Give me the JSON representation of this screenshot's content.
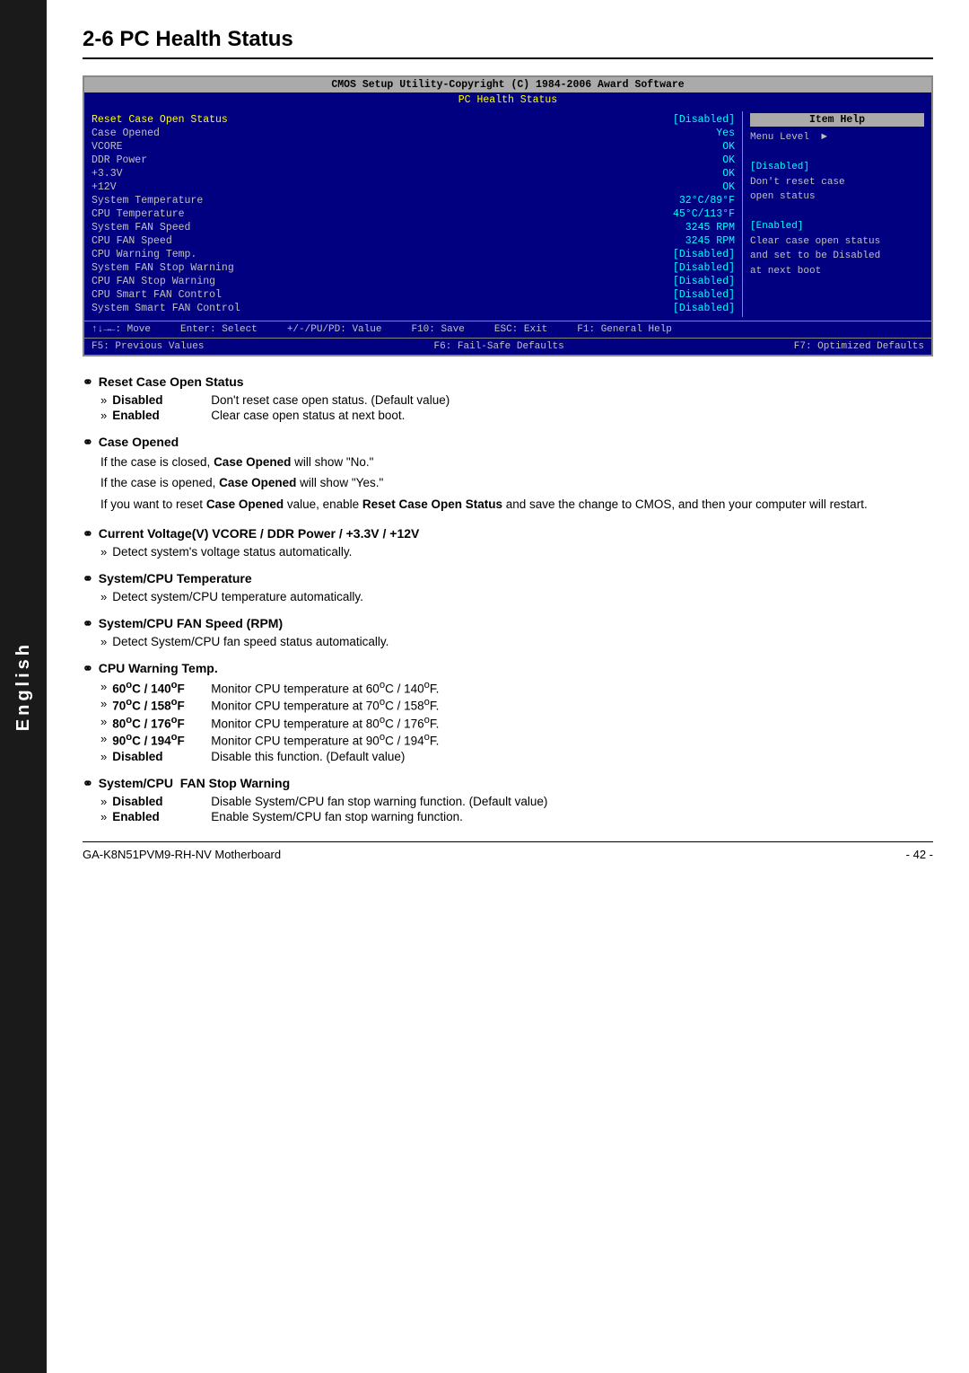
{
  "sidebar": {
    "label": "English"
  },
  "page": {
    "title": "2-6   PC Health Status"
  },
  "bios": {
    "title_bar": "CMOS Setup Utility-Copyright (C) 1984-2006 Award Software",
    "subtitle": "PC Health Status",
    "rows": [
      {
        "label": "Reset Case Open Status",
        "value": "[Disabled]",
        "highlight": true
      },
      {
        "label": "Case Opened",
        "value": "Yes",
        "highlight": false
      },
      {
        "label": "VCORE",
        "value": "OK",
        "highlight": false
      },
      {
        "label": "DDR Power",
        "value": "OK",
        "highlight": false
      },
      {
        "label": "+3.3V",
        "value": "OK",
        "highlight": false
      },
      {
        "label": "+12V",
        "value": "OK",
        "highlight": false
      },
      {
        "label": "System Temperature",
        "value": "32°C/89°F",
        "highlight": false
      },
      {
        "label": "CPU Temperature",
        "value": "45°C/113°F",
        "highlight": false
      },
      {
        "label": "System FAN Speed",
        "value": "3245 RPM",
        "highlight": false
      },
      {
        "label": "CPU FAN Speed",
        "value": "3245 RPM",
        "highlight": false
      },
      {
        "label": "CPU Warning Temp.",
        "value": "[Disabled]",
        "highlight": false
      },
      {
        "label": "System FAN Stop Warning",
        "value": "[Disabled]",
        "highlight": false
      },
      {
        "label": "CPU FAN Stop Warning",
        "value": "[Disabled]",
        "highlight": false
      },
      {
        "label": "CPU Smart FAN Control",
        "value": "[Disabled]",
        "highlight": false
      },
      {
        "label": "System Smart FAN Control",
        "value": "[Disabled]",
        "highlight": false
      }
    ],
    "item_help_title": "Item Help",
    "item_help_lines": [
      "Menu Level  ▶",
      "",
      "[Disabled]",
      "Don't reset case",
      "open status",
      "",
      "[Enabled]",
      "Clear case open status",
      "and set to be Disabled",
      "at next boot"
    ],
    "footer_left": "↑↓→←: Move    Enter: Select    +/-/PU/PD: Value    F10: Save    ESC: Exit    F1: General Help",
    "footer_left1": "↑↓→←: Move",
    "footer_left2": "Enter: Select",
    "footer_mid1": "+/-/PU/PD: Value",
    "footer_mid2": "F10: Save",
    "footer_right1": "ESC: Exit",
    "footer_right2": "F1: General Help",
    "footer_row2_left": "F5: Previous Values",
    "footer_row2_mid": "F6: Fail-Safe Defaults",
    "footer_row2_right": "F7: Optimized Defaults"
  },
  "sections": [
    {
      "id": "reset-case",
      "title": "Reset Case Open Status",
      "items": [
        {
          "label": "Disabled",
          "desc": "Don't reset case open status. (Default value)"
        },
        {
          "label": "Enabled",
          "desc": "Clear case open status at next boot."
        }
      ],
      "paragraphs": []
    },
    {
      "id": "case-opened",
      "title": "Case Opened",
      "items": [],
      "paragraphs": [
        "If the case is closed, <b>Case Opened</b> will show \"No.\"",
        "If the case is opened, <b>Case Opened</b> will show \"Yes.\"",
        "If you want to reset <b>Case Opened</b> value, enable <b>Reset Case Open Status</b> and save the change to CMOS, and then your computer will restart."
      ]
    },
    {
      "id": "current-voltage",
      "title": "Current Voltage(V) VCORE / DDR Power / +3.3V / +12V",
      "items": [
        {
          "label": "",
          "desc": "Detect system's voltage status automatically."
        }
      ],
      "paragraphs": []
    },
    {
      "id": "system-cpu-temp",
      "title": "System/CPU Temperature",
      "items": [
        {
          "label": "",
          "desc": "Detect system/CPU temperature automatically."
        }
      ],
      "paragraphs": []
    },
    {
      "id": "fan-speed",
      "title": "System/CPU FAN Speed (RPM)",
      "items": [
        {
          "label": "",
          "desc": "Detect System/CPU fan speed status automatically."
        }
      ],
      "paragraphs": []
    },
    {
      "id": "cpu-warning-temp",
      "title": "CPU Warning Temp.",
      "items": [
        {
          "label": "60°C / 140°F",
          "desc": "Monitor CPU temperature at 60°C / 140°F."
        },
        {
          "label": "70°C / 158°F",
          "desc": "Monitor CPU temperature at 70°C / 158°F."
        },
        {
          "label": "80°C / 176°F",
          "desc": "Monitor CPU temperature at 80°C / 176°F."
        },
        {
          "label": "90°C / 194°F",
          "desc": "Monitor CPU temperature at 90°C / 194°F."
        },
        {
          "label": "Disabled",
          "desc": "Disable this function. (Default value)"
        }
      ],
      "paragraphs": []
    },
    {
      "id": "fan-stop-warning",
      "title": "System/CPU  FAN Stop Warning",
      "items": [
        {
          "label": "Disabled",
          "desc": "Disable System/CPU fan stop warning function. (Default value)"
        },
        {
          "label": "Enabled",
          "desc": "Enable System/CPU fan stop warning function."
        }
      ],
      "paragraphs": []
    }
  ],
  "footer": {
    "left": "GA-K8N51PVM9-RH-NV Motherboard",
    "right": "- 42 -"
  }
}
